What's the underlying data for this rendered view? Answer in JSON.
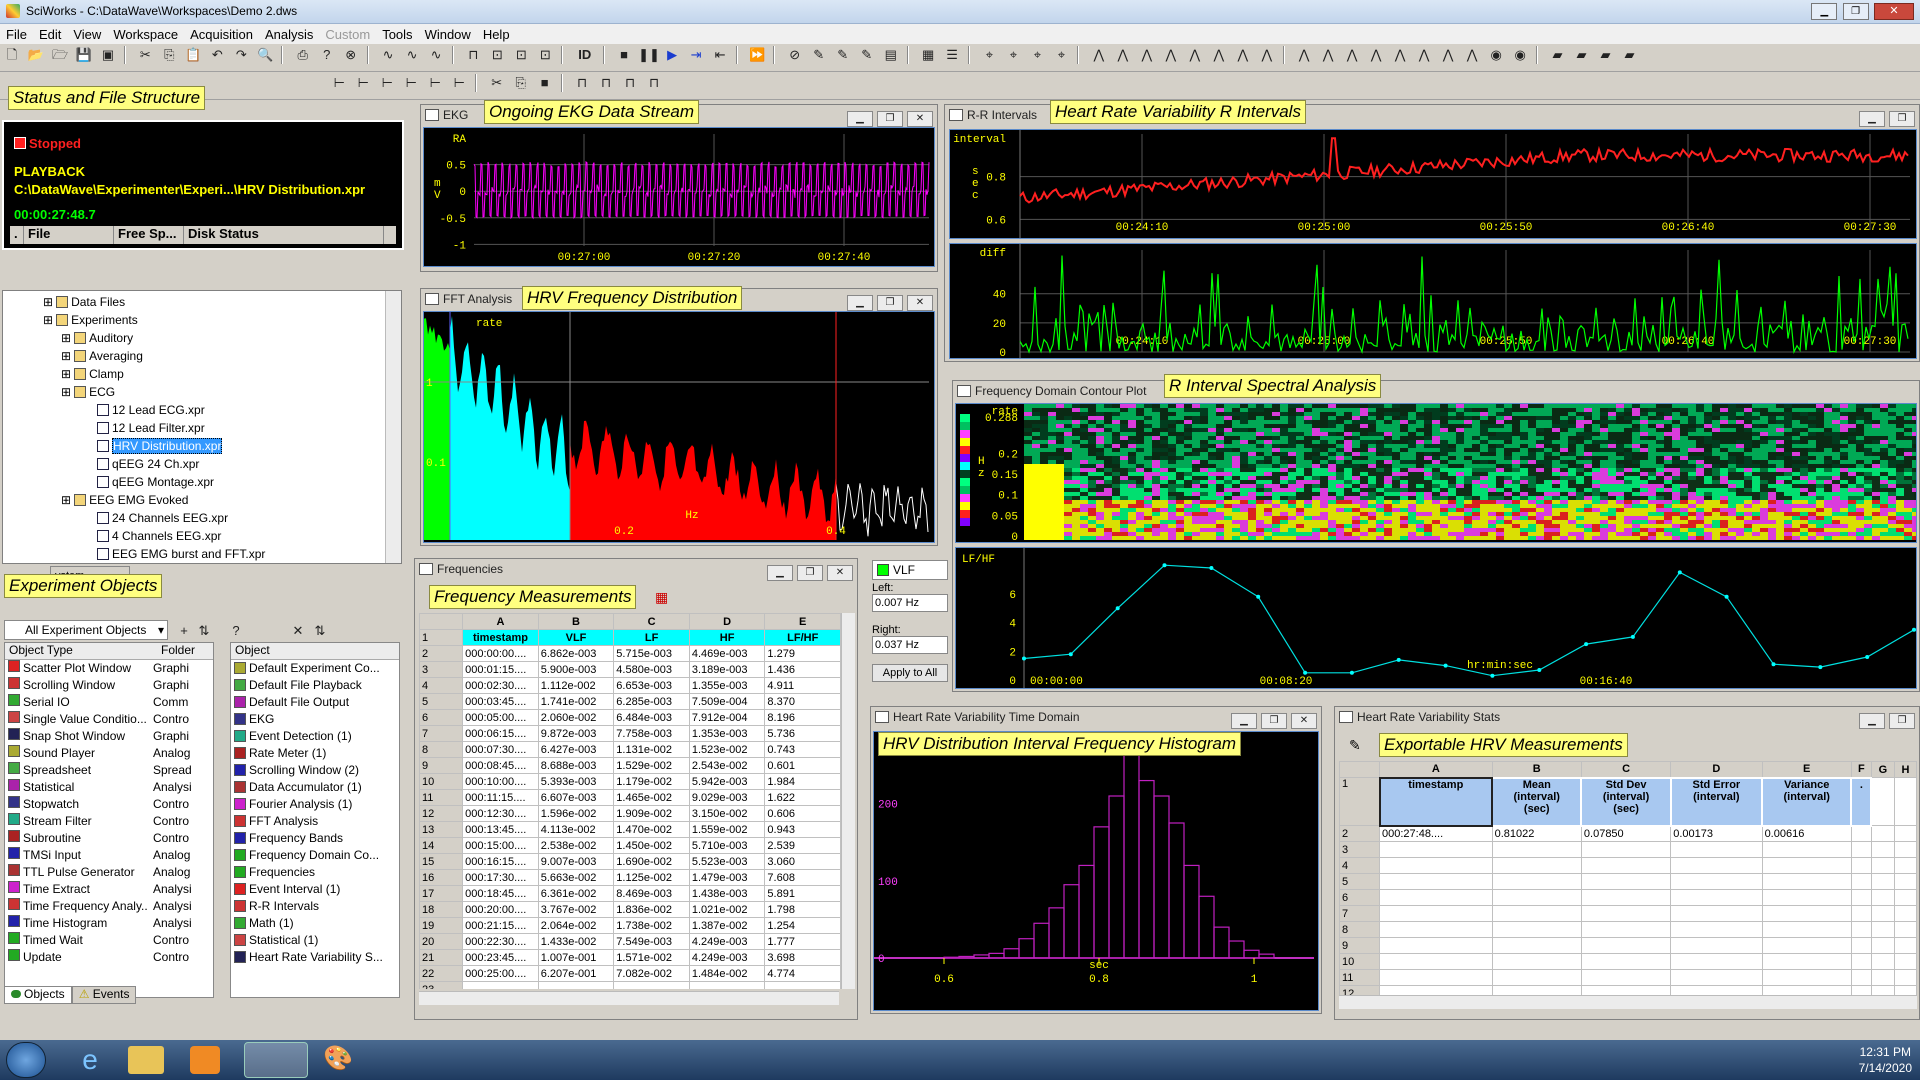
{
  "title": "SciWorks - C:\\DataWave\\Workspaces\\Demo 2.dws",
  "menu": [
    "File",
    "Edit",
    "View",
    "Workspace",
    "Acquisition",
    "Analysis",
    "Custom",
    "Tools",
    "Window",
    "Help"
  ],
  "toolbar_id": "ID",
  "labels": {
    "status": "Status and File Structure",
    "ekg": "Ongoing EKG Data Stream",
    "fft": "HRV Frequency Distribution",
    "rr": "Heart Rate Variability R Intervals",
    "contour": "R Interval Spectral Analysis",
    "freq": "Frequency Measurements",
    "hist": "HRV Distribution Interval Frequency Histogram",
    "stats": "Exportable HRV Measurements",
    "objects": "Experiment Objects"
  },
  "status": {
    "state": "Stopped",
    "mode": "PLAYBACK",
    "path": "C:\\DataWave\\Experimenter\\Experi...\\HRV Distribution.xpr",
    "time": "00:00:27:48.7",
    "cols": [
      ".",
      "File",
      "Free Sp...",
      "Disk Status"
    ]
  },
  "tree": [
    {
      "t": "Data Files",
      "i": 2,
      "f": true
    },
    {
      "t": "Experiments",
      "i": 2,
      "f": true
    },
    {
      "t": "Auditory",
      "i": 3,
      "f": true
    },
    {
      "t": "Averaging",
      "i": 3,
      "f": true
    },
    {
      "t": "Clamp",
      "i": 3,
      "f": true
    },
    {
      "t": "ECG",
      "i": 3,
      "f": true
    },
    {
      "t": "12 Lead ECG.xpr",
      "i": 5
    },
    {
      "t": "12 Lead Filter.xpr",
      "i": 5
    },
    {
      "t": "HRV Distribution.xpr",
      "i": 5,
      "sel": true
    },
    {
      "t": "qEEG 24 Ch.xpr",
      "i": 5
    },
    {
      "t": "qEEG Montage.xpr",
      "i": 5
    },
    {
      "t": "EEG EMG Evoked",
      "i": 3,
      "f": true
    },
    {
      "t": "24 Channels EEG.xpr",
      "i": 5
    },
    {
      "t": "4 Channels EEG.xpr",
      "i": 5
    },
    {
      "t": "EEG EMG burst and FFT.xpr",
      "i": 5
    }
  ],
  "tree_tab": "ystem",
  "objects": {
    "filter": "All Experiment Objects",
    "left_headers": [
      "Object Type",
      "Folder"
    ],
    "right_header": "Object",
    "left": [
      [
        "Scatter Plot Window",
        "Graphi"
      ],
      [
        "Scrolling Window",
        "Graphi"
      ],
      [
        "Serial IO",
        "Comm"
      ],
      [
        "Single Value Conditio...",
        "Contro"
      ],
      [
        "Snap Shot Window",
        "Graphi"
      ],
      [
        "Sound Player",
        "Analog"
      ],
      [
        "Spreadsheet",
        "Spread"
      ],
      [
        "Statistical",
        "Analysi"
      ],
      [
        "Stopwatch",
        "Contro"
      ],
      [
        "Stream Filter",
        "Contro"
      ],
      [
        "Subroutine",
        "Contro"
      ],
      [
        "TMSi Input",
        "Analog"
      ],
      [
        "TTL Pulse Generator",
        "Analog"
      ],
      [
        "Time Extract",
        "Analysi"
      ],
      [
        "Time Frequency Analy...",
        "Analysi"
      ],
      [
        "Time Histogram",
        "Analysi"
      ],
      [
        "Timed Wait",
        "Contro"
      ],
      [
        "Update",
        "Contro"
      ]
    ],
    "right": [
      "Default Experiment Co...",
      "Default File Playback",
      "Default File Output",
      "EKG",
      "Event Detection (1)",
      "Rate Meter (1)",
      "Scrolling Window (2)",
      "Data Accumulator (1)",
      "Fourier Analysis (1)",
      "FFT Analysis",
      "Frequency Bands",
      "Frequency Domain Co...",
      "Frequencies",
      "Event Interval (1)",
      "R-R Intervals",
      "Math (1)",
      "Statistical (1)",
      "Heart Rate Variability S..."
    ],
    "tabs": [
      "Objects",
      "Events"
    ]
  },
  "ekg": {
    "title": "EKG",
    "yticks": [
      "0.5",
      "0",
      "-0.5",
      "-1"
    ],
    "ylabel": "RA",
    "yunit": "m\nV",
    "xticks": [
      "00:27:00",
      "00:27:20",
      "00:27:40"
    ]
  },
  "fft": {
    "title": "FFT Analysis",
    "rate": "rate",
    "ylabels": [
      "1",
      "0.1"
    ],
    "xticks": [
      "0.2",
      "Hz",
      "0.4"
    ]
  },
  "rr": {
    "title": "R-R Intervals",
    "top_label": "interval",
    "top_yticks": [
      "0.8",
      "0.6"
    ],
    "top_unit": "s\ne\nc",
    "bottom_label": "diff",
    "bottom_yticks": [
      "40",
      "20",
      "0"
    ],
    "xticks": [
      "00:24:10",
      "00:25:00",
      "00:25:50",
      "00:26:40",
      "00:27:30"
    ]
  },
  "contour": {
    "title": "Frequency Domain Contour Plot",
    "rate": "rate",
    "yticks": [
      "0.288",
      "0.2",
      "0.15",
      "0.1",
      "0.05",
      "0"
    ],
    "yunit": "H\nz",
    "lfhf": "LF/HF",
    "lf_yticks": [
      "6",
      "4",
      "2",
      "0"
    ],
    "xticks": [
      "00:00:00",
      "00:08:20",
      "hr:min:sec",
      "00:16:40"
    ],
    "lfhf_values": [
      1.5,
      1.8,
      5.0,
      8.0,
      7.8,
      5.8,
      0.5,
      0.5,
      1.4,
      1.0,
      0.3,
      0.7,
      2.5,
      3.0,
      7.5,
      5.8,
      1.1,
      0.9,
      1.6,
      3.5
    ]
  },
  "frequencies": {
    "title": "Frequencies",
    "col_letters": [
      "A",
      "B",
      "C",
      "D",
      "E"
    ],
    "headers": [
      "timestamp",
      "VLF",
      "LF",
      "HF",
      "LF/HF"
    ],
    "rows": [
      [
        "000:00:00....",
        "6.862e-003",
        "5.715e-003",
        "4.469e-003",
        "1.279"
      ],
      [
        "000:01:15....",
        "5.900e-003",
        "4.580e-003",
        "3.189e-003",
        "1.436"
      ],
      [
        "000:02:30....",
        "1.112e-002",
        "6.653e-003",
        "1.355e-003",
        "4.911"
      ],
      [
        "000:03:45....",
        "1.741e-002",
        "6.285e-003",
        "7.509e-004",
        "8.370"
      ],
      [
        "000:05:00....",
        "2.060e-002",
        "6.484e-003",
        "7.912e-004",
        "8.196"
      ],
      [
        "000:06:15....",
        "9.872e-003",
        "7.758e-003",
        "1.353e-003",
        "5.736"
      ],
      [
        "000:07:30....",
        "6.427e-003",
        "1.131e-002",
        "1.523e-002",
        "0.743"
      ],
      [
        "000:08:45....",
        "8.688e-003",
        "1.529e-002",
        "2.543e-002",
        "0.601"
      ],
      [
        "000:10:00....",
        "5.393e-003",
        "1.179e-002",
        "5.942e-003",
        "1.984"
      ],
      [
        "000:11:15....",
        "6.607e-003",
        "1.465e-002",
        "9.029e-003",
        "1.622"
      ],
      [
        "000:12:30....",
        "1.596e-002",
        "1.909e-002",
        "3.150e-002",
        "0.606"
      ],
      [
        "000:13:45....",
        "4.113e-002",
        "1.470e-002",
        "1.559e-002",
        "0.943"
      ],
      [
        "000:15:00....",
        "2.538e-002",
        "1.450e-002",
        "5.710e-003",
        "2.539"
      ],
      [
        "000:16:15....",
        "9.007e-003",
        "1.690e-002",
        "5.523e-003",
        "3.060"
      ],
      [
        "000:17:30....",
        "5.663e-002",
        "1.125e-002",
        "1.479e-003",
        "7.608"
      ],
      [
        "000:18:45....",
        "6.361e-002",
        "8.469e-003",
        "1.438e-003",
        "5.891"
      ],
      [
        "000:20:00....",
        "3.767e-002",
        "1.836e-002",
        "1.021e-002",
        "1.798"
      ],
      [
        "000:21:15....",
        "2.064e-002",
        "1.738e-002",
        "1.387e-002",
        "1.254"
      ],
      [
        "000:22:30....",
        "1.433e-002",
        "7.549e-003",
        "4.249e-003",
        "1.777"
      ],
      [
        "000:23:45....",
        "1.007e-001",
        "1.571e-002",
        "4.249e-003",
        "3.698"
      ],
      [
        "000:25:00....",
        "6.207e-001",
        "7.082e-002",
        "1.484e-002",
        "4.774"
      ]
    ],
    "last_row_num": "23"
  },
  "bands": {
    "name": "VLF",
    "left_label": "Left:",
    "left": "0.007 Hz",
    "right_label": "Right:",
    "right": "0.037 Hz",
    "apply": "Apply to All"
  },
  "hist": {
    "title": "Heart Rate Variability Time Domain",
    "yticks": [
      "200",
      "100",
      "0"
    ],
    "xticks": [
      "0.6",
      "0.8",
      "1"
    ],
    "xunit": "sec",
    "counts": [
      1,
      2,
      4,
      6,
      12,
      25,
      45,
      65,
      95,
      120,
      170,
      210,
      265,
      230,
      210,
      175,
      120,
      80,
      40,
      22,
      10,
      5
    ]
  },
  "stats": {
    "title": "Heart Rate Variability Stats",
    "col_letters": [
      "A",
      "B",
      "C",
      "D",
      "E",
      "F",
      "G",
      "H"
    ],
    "headers": [
      "timestamp",
      "Mean\n(interval)\n(sec)",
      "Std Dev\n(interval)\n(sec)",
      "Std Error\n(interval)",
      "Variance\n(interval)",
      "."
    ],
    "row2": [
      "000:27:48....",
      "0.81022",
      "0.07850",
      "0.00173",
      "0.00616"
    ],
    "row_nums": [
      "1",
      "2",
      "3",
      "4",
      "5",
      "6",
      "7",
      "8",
      "9",
      "10",
      "11",
      "12"
    ]
  },
  "clock": {
    "time": "12:31 PM",
    "date": "7/14/2020"
  }
}
